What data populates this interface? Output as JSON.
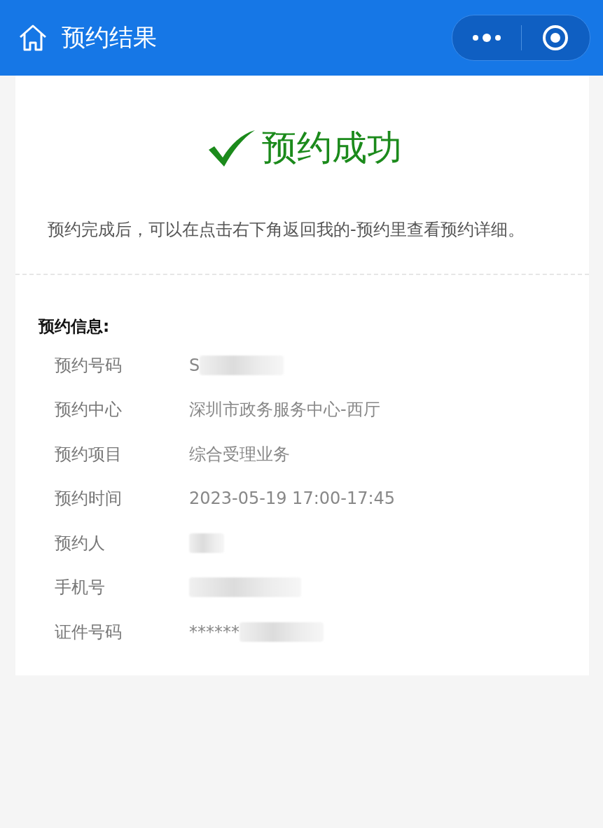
{
  "header": {
    "title": "预约结果"
  },
  "result": {
    "title": "预约成功",
    "note": "预约完成后，可以在点击右下角返回我的-预约里查看预约详细。"
  },
  "info": {
    "heading": "预约信息:",
    "rows": [
      {
        "label": "预约号码",
        "value": "S",
        "redacted": true
      },
      {
        "label": "预约中心",
        "value": "深圳市政务服务中心-西厅",
        "redacted": false
      },
      {
        "label": "预约项目",
        "value": "综合受理业务",
        "redacted": false
      },
      {
        "label": "预约时间",
        "value": "2023-05-19 17:00-17:45",
        "redacted": false
      },
      {
        "label": "预约人",
        "redacted": true
      },
      {
        "label": "手机号",
        "redacted": true
      },
      {
        "label": "证件号码",
        "value": "******",
        "redacted": true
      }
    ]
  }
}
